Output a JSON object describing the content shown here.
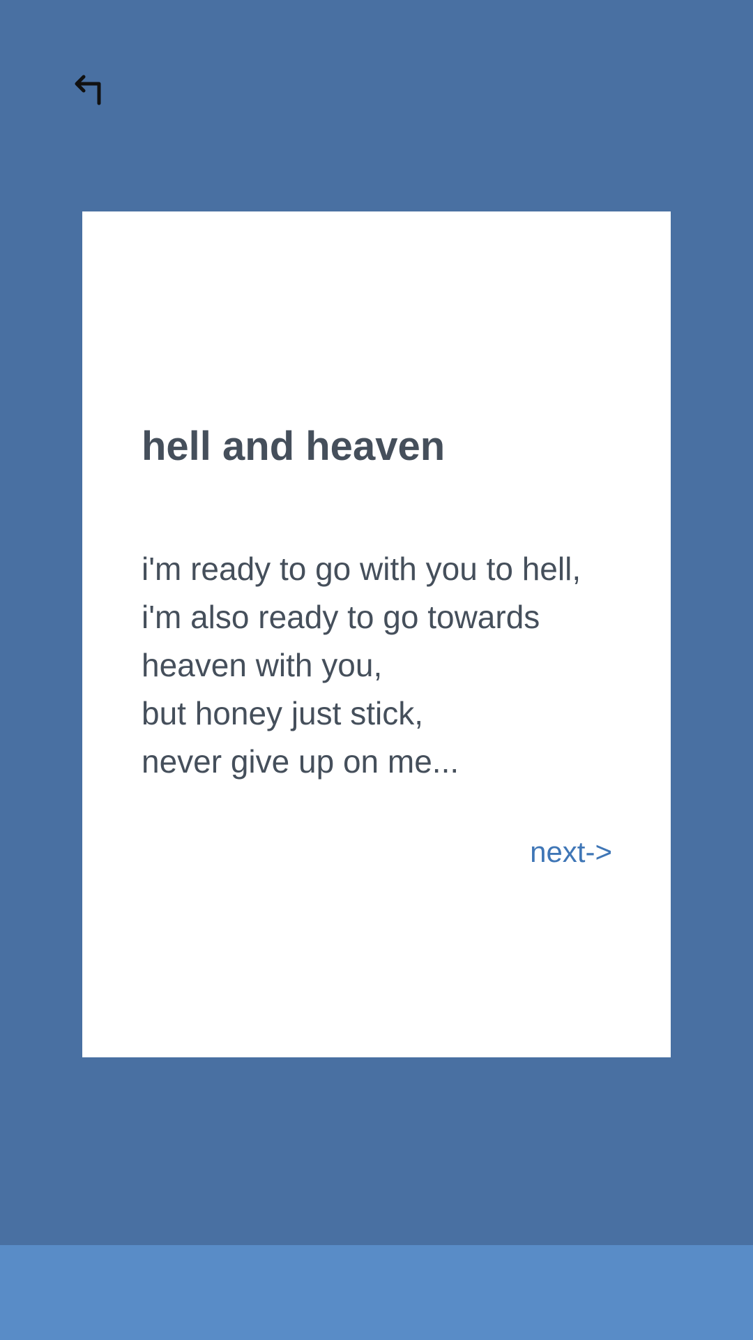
{
  "header": {
    "back_icon": "reply-arrow-icon"
  },
  "card": {
    "title": "hell and heaven",
    "lines": [
      "i'm ready to go with you to hell,",
      "i'm also ready to go towards",
      "heaven with you,",
      "but honey just stick,",
      "never give up on me..."
    ],
    "next_label": "next->"
  },
  "colors": {
    "background": "#4970a2",
    "card": "#ffffff",
    "text": "#454f5b",
    "link": "#3f76b6",
    "bottom_bar": "#598cc7"
  }
}
